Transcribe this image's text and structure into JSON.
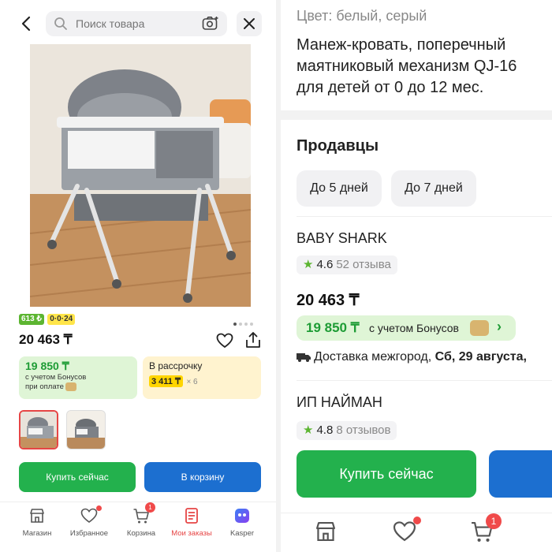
{
  "left": {
    "search": {
      "placeholder": "Поиск товара"
    },
    "badges": {
      "green": "613 ₺",
      "yellow": "0·0·24"
    },
    "price": "20 463 ₸",
    "bonus": {
      "price": "19 850 ₸",
      "text1": "с учетом Бонусов",
      "text2": "при оплате"
    },
    "installment": {
      "label": "В рассрочку",
      "price": "3 411 ₸",
      "multiplier": "× 6"
    },
    "buttons": {
      "buy": "Купить сейчас",
      "cart": "В корзину"
    },
    "tabs": [
      {
        "label": "Магазин",
        "icon": "store-icon"
      },
      {
        "label": "Избранное",
        "icon": "heart-icon"
      },
      {
        "label": "Корзина",
        "icon": "cart-icon",
        "count": "1"
      },
      {
        "label": "Мои заказы",
        "icon": "orders-icon"
      },
      {
        "label": "Kasper",
        "icon": "kasper-icon"
      }
    ],
    "active_tab_color": "#e64545"
  },
  "right": {
    "color_line": "Цвет: белый, серый",
    "title_lines": [
      "Манеж-кровать, поперечный",
      "маятниковый механизм QJ-16",
      "для детей от 0 до 12 мес."
    ],
    "sellers_heading": "Продавцы",
    "chips": [
      "До 5 дней",
      "До 7 дней"
    ],
    "sellers": [
      {
        "name": "BABY SHARK",
        "rating": "4.6",
        "reviews": "52 отзыва",
        "price": "20 463 ₸",
        "bonus_price": "19 850 ₸",
        "bonus_text": "с учетом Бонусов",
        "delivery_prefix": "Доставка межгород,",
        "delivery_date": "Сб, 29 августа,"
      },
      {
        "name": "ИП НАЙМАН",
        "rating": "4.8",
        "reviews": "8 отзывов"
      }
    ],
    "buy_button": "Купить сейчас",
    "cart_count": "1"
  },
  "colors": {
    "green": "#23b14d",
    "blue": "#1c6fd0",
    "red": "#f04a4a",
    "bonus_bg": "#dff5d6"
  }
}
